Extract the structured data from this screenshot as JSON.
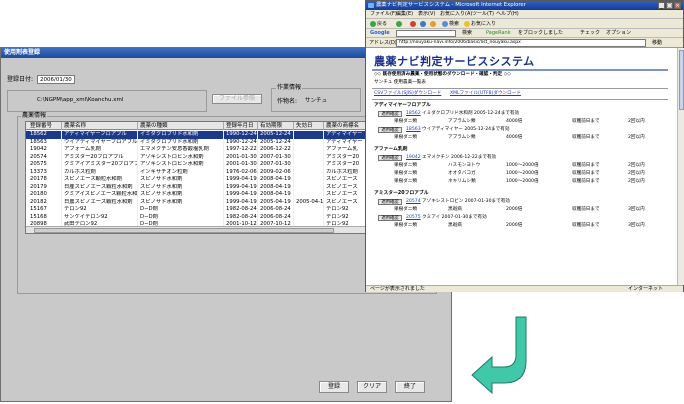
{
  "back_window": {
    "title": "使用剤表登録",
    "reg_date_label": "登録日付:",
    "reg_date": "2006/01/30",
    "file_path": "C:\\NGPM\\app_xml\\Koanchu.xml",
    "file_button": "ファイル参照",
    "work_info_label": "作業情報",
    "crop_label": "作物名:",
    "crop_value": "サンチュ",
    "pesticide_info_label": "農薬情報",
    "columns": [
      "登録番号",
      "農薬名称",
      "農薬の種類",
      "登録年月日",
      "有効期限",
      "失効日",
      "農薬の商標名"
    ],
    "rows": [
      [
        "18562",
        "アディマイヤーフロアブル",
        "イミダクロプリド水和剤",
        "1990-12-24",
        "2005-12-24",
        "",
        "アディマイヤー"
      ],
      [
        "18563",
        "ウイアディマイヤーフロアブル",
        "イミダクロプリド水和剤",
        "1990-12-24",
        "2005-12-24",
        "",
        "アディマイヤー"
      ],
      [
        "19042",
        "アフォーム乳剤",
        "エマメクチン安息香酸塩乳剤",
        "1997-12-22",
        "2006-12-22",
        "",
        "アファーム乳"
      ],
      [
        "20574",
        "アミスター20フロアブル",
        "アゾキシストロビン水和剤",
        "2001-01-30",
        "2007-01-30",
        "",
        "アミスター20"
      ],
      [
        "20575",
        "クミアイアミスター20フロアブル",
        "アゾキシストロビン水和剤",
        "2001-01-30",
        "2007-01-30",
        "",
        "アミスター20"
      ],
      [
        "13373",
        "カルホス粒剤",
        "インキサチオン粒剤",
        "1976-02-06",
        "2009-02-06",
        "",
        "カルホス粒剤"
      ],
      [
        "20178",
        "スピノエース顆粒水和剤",
        "スピノサド水和剤",
        "1999-04-19",
        "2008-04-19",
        "",
        "スピノエース"
      ],
      [
        "20179",
        "日産スピノエース顆粒水和剤",
        "スピノサド水和剤",
        "1999-04-19",
        "2008-04-19",
        "",
        "スピノエース"
      ],
      [
        "20180",
        "クミアイスピノエース顆粒水和剤",
        "スピノサド水和剤",
        "1999-04-19",
        "2008-04-19",
        "",
        "スピノエース"
      ],
      [
        "20182",
        "日農スピノエース顆粒水和剤",
        "スピノサド水和剤",
        "1999-04-19",
        "2005-04-19",
        "2005-04-19",
        "スピノエース"
      ],
      [
        "15167",
        "テロン92",
        "D−D剤",
        "1982-08-24",
        "2006-08-24",
        "",
        "テロン92"
      ],
      [
        "15168",
        "サンケイテロン92",
        "D−D剤",
        "1982-08-24",
        "2006-08-24",
        "",
        "テロン92"
      ],
      [
        "20898",
        "武田テロン92",
        "D−D剤",
        "2001-10-12",
        "2007-10-12",
        "",
        "テロン92"
      ]
    ],
    "selected_row": 0,
    "buttons": {
      "register": "登録",
      "clear": "クリア",
      "close": "終了"
    }
  },
  "browser": {
    "title": "農薬ナビ判定サービスシステム - Microsoft Internet Explorer",
    "menu": [
      "ファイル(F)",
      "編集(E)",
      "表示(V)",
      "お気に入り(A)",
      "ツール(T)",
      "ヘルプ(H)"
    ],
    "toolbar": [
      "戻る",
      "検索",
      "お気に入り"
    ],
    "google_label": "Google",
    "google_items": [
      "検索",
      "PageRank",
      "をブロックしました",
      "チェック",
      "オプション"
    ],
    "address_label": "アドレス(D)",
    "address": "http://nouyaku-navi.info/2006/basic/list_nouyaku.aspx",
    "go_label": "移動",
    "page_title": "農薬ナビ判定サービスシステム",
    "subtitle": "◇◇ 既存使用済み農薬・使用状態のダウンロード・確認・判定 ◇◇",
    "crop_line": "サンチュ 使用農薬一覧表",
    "links": [
      "CSVファイル(SJIS)ダウンロード",
      "XMLファイル(UTF8)ダウンロード"
    ],
    "sections": [
      {
        "name": "アディマイヤーフロアブル",
        "entries": [
          {
            "button": "適用確認",
            "id": "18562",
            "text": "イミダクロプリド水和剤 2005-12-24まで有効",
            "pest": "果樹ダニ類",
            "target": "アブラムシ類",
            "rate": "4000倍",
            "limit": "収穫前日まで",
            "times": "2回以内"
          },
          {
            "button": "適用確認",
            "id": "18563",
            "text": "ウイアディマイヤー 2005-12-24まで有効",
            "pest": "果樹ダニ類",
            "target": "アブラムシ類",
            "rate": "4000倍",
            "limit": "収穫前日まで",
            "times": "2回以内"
          }
        ]
      },
      {
        "name": "アファーム乳剤",
        "entries": [
          {
            "button": "適用確認",
            "id": "19042",
            "text": "エマメクチン 2006-12-22まで有効",
            "pest": "果樹ダニ類",
            "target": "ハスモンヨトウ",
            "rate": "1000～2000倍",
            "limit": "収穫前日まで",
            "times": "2回以内"
          },
          {
            "button": "",
            "id": "",
            "text": "",
            "pest": "果樹ダニ類",
            "target": "オオタバコガ",
            "rate": "1000～2000倍",
            "limit": "収穫前日まで",
            "times": "2回以内"
          },
          {
            "button": "",
            "id": "",
            "text": "",
            "pest": "果樹ダニ類",
            "target": "ネキリムシ類",
            "rate": "1000～2000倍",
            "limit": "収穫前日まで",
            "times": "2回以内"
          }
        ]
      },
      {
        "name": "アミスター20フロアブル",
        "entries": [
          {
            "button": "適用確認",
            "id": "20574",
            "text": "アゾキシストロビン 2007-01-30まで有効",
            "pest": "果樹ダニ類",
            "target": "黒斑病",
            "rate": "2000倍",
            "limit": "収穫前日まで",
            "times": "3回以内"
          },
          {
            "button": "適用確認",
            "id": "20575",
            "text": "クミアイ 2007-01-30まで有効",
            "pest": "果樹ダニ類",
            "target": "黒斑病",
            "rate": "2000倍",
            "limit": "収穫前日まで",
            "times": "3回以内"
          }
        ]
      }
    ],
    "status": "ページが表示されました",
    "zone": "インターネット"
  },
  "accent": "#1a2f88",
  "arrow_color": "#40c8a8"
}
